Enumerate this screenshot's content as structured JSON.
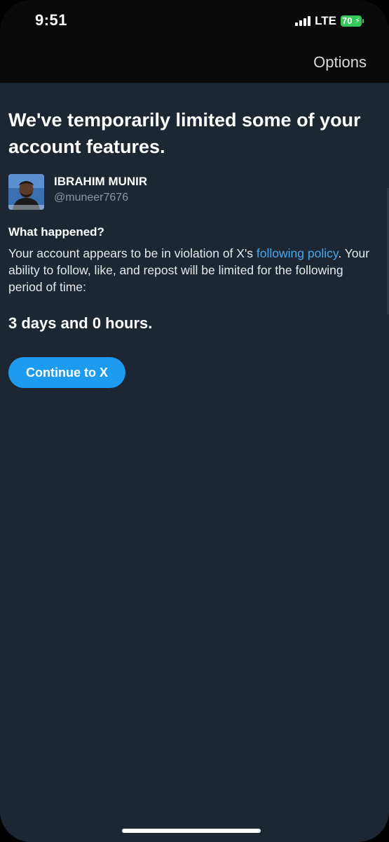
{
  "status_bar": {
    "time": "9:51",
    "network": "LTE",
    "battery": "70"
  },
  "nav": {
    "options_label": "Options"
  },
  "main": {
    "title": "We've temporarily limited some of your account features.",
    "profile": {
      "name": "IBRAHIM MUNIR",
      "handle": "@muneer7676"
    },
    "section_heading": "What happened?",
    "body_prefix": "Your account appears to be in violation of X's ",
    "policy_link": "following policy",
    "body_suffix": ". Your ability to follow, like, and repost will be limited for the following period of time:",
    "duration": "3 days and 0 hours.",
    "continue_label": "Continue to X"
  },
  "colors": {
    "background": "#1c2733",
    "top_bar": "#0a0a0a",
    "accent": "#1d9bf0",
    "link": "#4ea6e6",
    "battery": "#34c759"
  }
}
